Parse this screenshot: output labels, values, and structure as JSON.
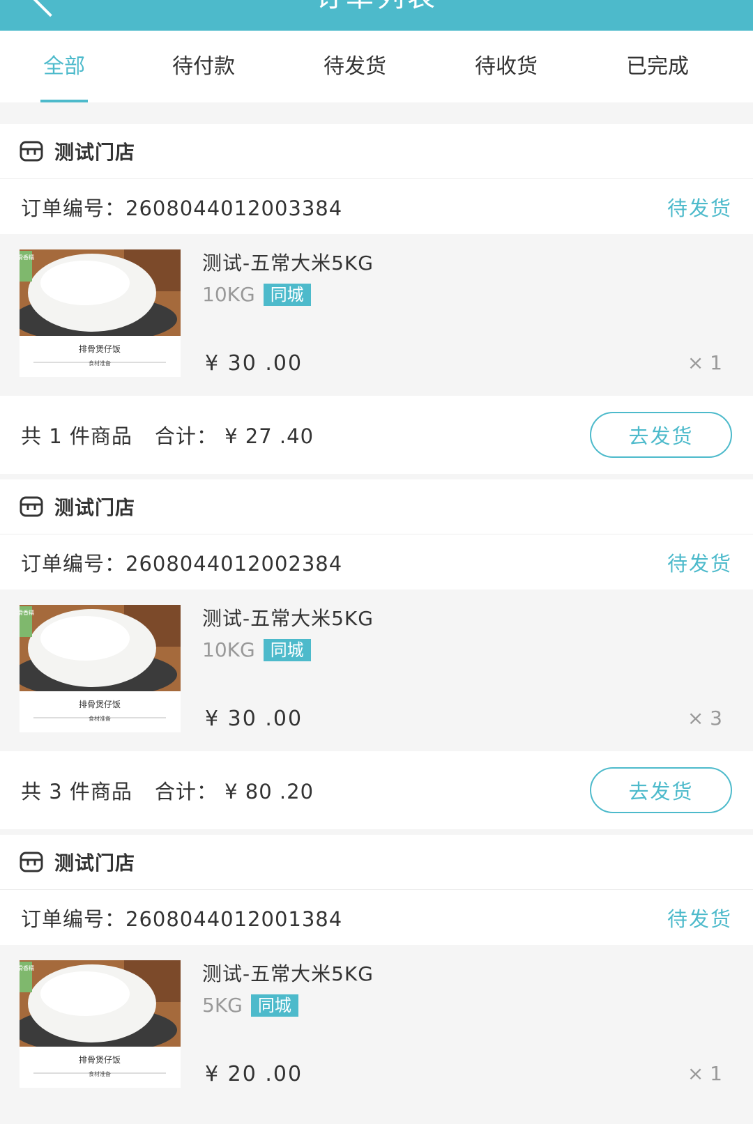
{
  "header": {
    "title": "订单列表"
  },
  "tabs": [
    {
      "label": "全部",
      "active": true
    },
    {
      "label": "待付款",
      "active": false
    },
    {
      "label": "待发货",
      "active": false
    },
    {
      "label": "待收货",
      "active": false
    },
    {
      "label": "已完成",
      "active": false
    }
  ],
  "colors": {
    "accent": "#4dbacb",
    "background": "#f5f5f5",
    "muted": "#999999"
  },
  "product_image": {
    "badge": "滑香糯",
    "caption": "排骨煲仔饭",
    "subcaption": "食材准备"
  },
  "orders": [
    {
      "store": "测试门店",
      "order_no": "订单编号：2608044012003384",
      "status": "待发货",
      "goods": {
        "name": "测试-五常大米5KG",
        "spec": "10KG",
        "tag": "同城",
        "price": "¥ 30 .00",
        "qty": "× 1"
      },
      "count_text": "共 1 件商品",
      "total_text": "合计： ¥ 27 .40",
      "action": "去发货"
    },
    {
      "store": "测试门店",
      "order_no": "订单编号：2608044012002384",
      "status": "待发货",
      "goods": {
        "name": "测试-五常大米5KG",
        "spec": "10KG",
        "tag": "同城",
        "price": "¥ 30 .00",
        "qty": "× 3"
      },
      "count_text": "共 3 件商品",
      "total_text": "合计： ¥ 80 .20",
      "action": "去发货"
    },
    {
      "store": "测试门店",
      "order_no": "订单编号：2608044012001384",
      "status": "待发货",
      "goods": {
        "name": "测试-五常大米5KG",
        "spec": "5KG",
        "tag": "同城",
        "price": "¥ 20 .00",
        "qty": "× 1"
      }
    }
  ]
}
